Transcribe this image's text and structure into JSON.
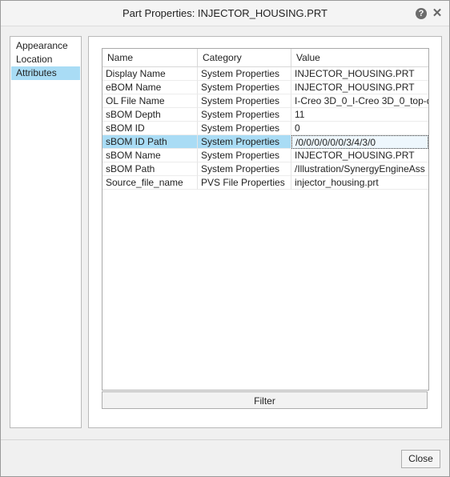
{
  "window": {
    "title": "Part Properties: INJECTOR_HOUSING.PRT",
    "help_icon": "?",
    "close_icon": "✕"
  },
  "nav": {
    "items": [
      {
        "label": "Appearance"
      },
      {
        "label": "Location"
      },
      {
        "label": "Attributes"
      }
    ],
    "selected": "Attributes"
  },
  "table": {
    "columns": [
      "Name",
      "Category",
      "Value"
    ],
    "rows": [
      {
        "name": "Display Name",
        "category": "System Properties",
        "value": "INJECTOR_HOUSING.PRT"
      },
      {
        "name": "eBOM Name",
        "category": "System Properties",
        "value": "INJECTOR_HOUSING.PRT"
      },
      {
        "name": "OL File Name",
        "category": "System Properties",
        "value": "I-Creo 3D_0_I-Creo 3D_0_top-d"
      },
      {
        "name": "sBOM Depth",
        "category": "System Properties",
        "value": "11"
      },
      {
        "name": "sBOM ID",
        "category": "System Properties",
        "value": "0"
      },
      {
        "name": "sBOM ID Path",
        "category": "System Properties",
        "value": "/0/0/0/0/0/0/3/4/3/0"
      },
      {
        "name": "sBOM Name",
        "category": "System Properties",
        "value": "INJECTOR_HOUSING.PRT"
      },
      {
        "name": "sBOM Path",
        "category": "System Properties",
        "value": "/Illustration/SynergyEngineAss"
      },
      {
        "name": "Source_file_name",
        "category": "PVS File Properties",
        "value": "injector_housing.prt"
      }
    ],
    "selected_row": "sBOM ID Path"
  },
  "buttons": {
    "filter": "Filter",
    "close": "Close"
  },
  "colors": {
    "selection": "#a9dcf5"
  }
}
